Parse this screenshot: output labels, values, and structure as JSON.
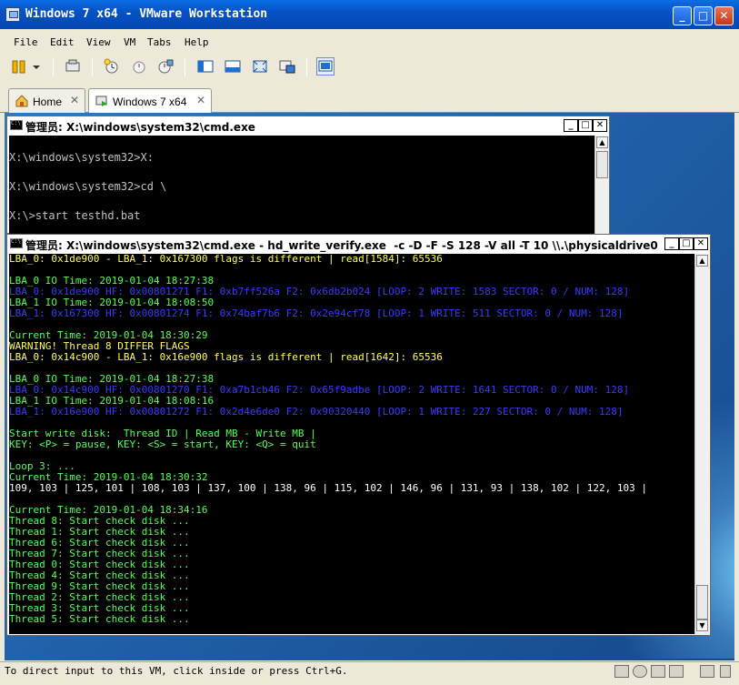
{
  "window": {
    "title": "Windows 7 x64 - VMware Workstation",
    "minimize": "_",
    "maximize": "□",
    "close": "✕"
  },
  "menu": [
    "File",
    "Edit",
    "View",
    "VM",
    "Tabs",
    "Help"
  ],
  "tabs": [
    {
      "label": "Home",
      "icon": "home-icon"
    },
    {
      "label": "Windows 7 x64",
      "icon": "vm-running-icon"
    }
  ],
  "cmd1": {
    "title": "管理员: X:\\windows\\system32\\cmd.exe",
    "lines": [
      "",
      "X:\\windows\\system32>X:",
      "",
      "X:\\windows\\system32>cd \\",
      "",
      "X:\\>start testhd.bat"
    ]
  },
  "cmd2": {
    "title": "管理员: X:\\windows\\system32\\cmd.exe - hd_write_verify.exe  -c -D -F -S 128 -V all -T 10 \\\\.\\physicaldrive0",
    "lines": [
      {
        "t": "LBA_0: 0x1de900 - LBA_1: 0x167300 flags is different | read[1584]: 65536",
        "c": "yellow"
      },
      {
        "t": "",
        "c": "gray"
      },
      {
        "t": "LBA_0 IO Time: 2019-01-04 18:27:38",
        "c": "green"
      },
      {
        "t": "LBA_0: 0x1de900 HF: 0x00801271 F1: 0xb7ff526a F2: 0x6db2b024 [LOOP: 2 WRITE: 1583 SECTOR: 0 / NUM: 128]",
        "c": "blue"
      },
      {
        "t": "LBA_1 IO Time: 2019-01-04 18:08:50",
        "c": "green"
      },
      {
        "t": "LBA_1: 0x167300 HF: 0x00801274 F1: 0x74baf7b6 F2: 0x2e94cf78 [LOOP: 1 WRITE: 511 SECTOR: 0 / NUM: 128]",
        "c": "blue"
      },
      {
        "t": "",
        "c": "gray"
      },
      {
        "t": "Current Time: 2019-01-04 18:30:29",
        "c": "green"
      },
      {
        "t": "WARNING! Thread 8 DIFFER FLAGS",
        "c": "yellow"
      },
      {
        "t": "LBA_0: 0x14c900 - LBA_1: 0x16e900 flags is different | read[1642]: 65536",
        "c": "yellow"
      },
      {
        "t": "",
        "c": "gray"
      },
      {
        "t": "LBA_0 IO Time: 2019-01-04 18:27:38",
        "c": "green"
      },
      {
        "t": "LBA_0: 0x14c900 HF: 0x00801270 F1: 0xa7b1cb46 F2: 0x65f9adbe [LOOP: 2 WRITE: 1641 SECTOR: 0 / NUM: 128]",
        "c": "blue"
      },
      {
        "t": "LBA_1 IO Time: 2019-01-04 18:08:16",
        "c": "green"
      },
      {
        "t": "LBA_1: 0x16e900 HF: 0x00801272 F1: 0x2d4e6de0 F2: 0x90320440 [LOOP: 1 WRITE: 227 SECTOR: 0 / NUM: 128]",
        "c": "blue"
      },
      {
        "t": "",
        "c": "gray"
      },
      {
        "t": "Start write disk:  Thread ID | Read MB - Write MB |",
        "c": "green"
      },
      {
        "t": "KEY: <P> = pause, KEY: <S> = start, KEY: <Q> = quit",
        "c": "green"
      },
      {
        "t": "",
        "c": "gray"
      },
      {
        "t": "Loop 3: ...",
        "c": "green"
      },
      {
        "t": "Current Time: 2019-01-04 18:30:32",
        "c": "green"
      },
      {
        "t": "109, 103 | 125, 101 | 108, 103 | 137, 100 | 138, 96 | 115, 102 | 146, 96 | 131, 93 | 138, 102 | 122, 103 |",
        "c": "white"
      },
      {
        "t": "",
        "c": "gray"
      },
      {
        "t": "Current Time: 2019-01-04 18:34:16",
        "c": "green"
      },
      {
        "t": "Thread 8: Start check disk ...",
        "c": "green"
      },
      {
        "t": "Thread 1: Start check disk ...",
        "c": "green"
      },
      {
        "t": "Thread 6: Start check disk ...",
        "c": "green"
      },
      {
        "t": "Thread 7: Start check disk ...",
        "c": "green"
      },
      {
        "t": "Thread 0: Start check disk ...",
        "c": "green"
      },
      {
        "t": "Thread 4: Start check disk ...",
        "c": "green"
      },
      {
        "t": "Thread 9: Start check disk ...",
        "c": "green"
      },
      {
        "t": "Thread 2: Start check disk ...",
        "c": "green"
      },
      {
        "t": "Thread 3: Start check disk ...",
        "c": "green"
      },
      {
        "t": "Thread 5: Start check disk ...",
        "c": "green"
      },
      {
        "t": "_",
        "c": "gray"
      }
    ]
  },
  "status": {
    "text": "To direct input to this VM, click inside or press Ctrl+G."
  },
  "colors": {
    "titlebar": "#0652c5",
    "desktop": "#1f5fa8",
    "console_bg": "#000000",
    "green": "#55ff55",
    "yellow": "#ffff55",
    "blue": "#3a3aff"
  }
}
